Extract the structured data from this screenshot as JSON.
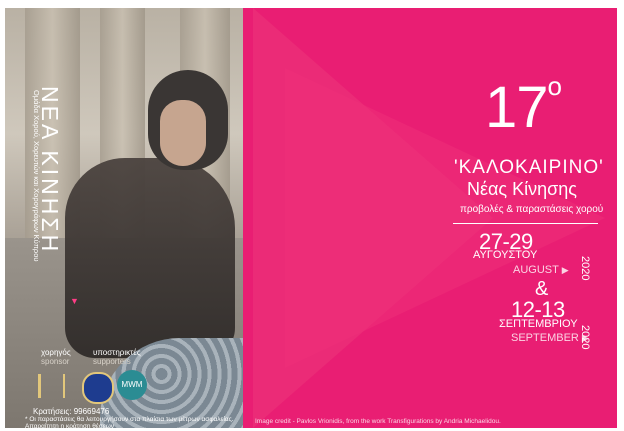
{
  "poster": {
    "vertical_title": "ΝΕΑ ΚΙΝΗΣΗ",
    "vertical_subtitle": "Ομάδα Χορού, Χορευτών και Χορογράφων Κύπρου",
    "edition": "17",
    "edition_sup": "ο",
    "title_line1": "'ΚΑΛΟΚΑΙΡΙΝΟ'",
    "title_line2": "Νέας Κίνησης",
    "subtitle": "προβολές & παραστάσεις χορού",
    "date1": "27-29",
    "month1_gr": "ΑΥΓΟΥΣΤΟΥ",
    "month1_en": "AUGUST",
    "year1": "2020",
    "ampersand": "&",
    "date2": "12-13",
    "month2_gr": "ΣΕΠΤΕΜΒΡΙΟΥ",
    "month2_en": "SEPTEMBER",
    "year2": "2020",
    "sponsor_gr": "χορηγός",
    "sponsor_en": "sponsor",
    "supporters_gr": "υποστηρικτές",
    "supporters_en": "supporters",
    "logo3_text": "MWM",
    "booking": "Κρατήσεις: 99669476",
    "note": "* Οι παραστάσεις θα λειτουργήσουν στα πλαίσια των μέτρων ασφαλείας. Απαραίτητη η κράτηση θέσεων",
    "credit": "Image credit - Pavlos Vrionidis, from the work Transfigurations by Andria Michaelidou.",
    "colors": {
      "accent": "#e91e73",
      "text": "#ffffff"
    }
  }
}
